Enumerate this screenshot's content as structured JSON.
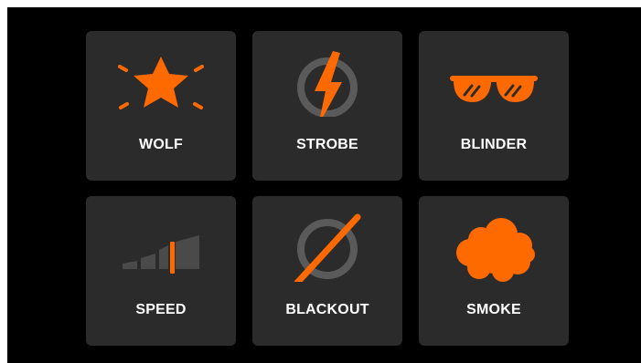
{
  "colors": {
    "accent": "#ff6a00",
    "tile": "#2b2b2b",
    "icon_gray": "#4a4a4a",
    "ring_gray": "#5a5a5a",
    "background": "#000000",
    "label": "#ffffff"
  },
  "tiles": [
    {
      "label": "WOLF",
      "icon": "star-burst-icon"
    },
    {
      "label": "STROBE",
      "icon": "lightning-ring-icon"
    },
    {
      "label": "BLINDER",
      "icon": "sunglasses-icon"
    },
    {
      "label": "SPEED",
      "icon": "speed-bars-icon"
    },
    {
      "label": "BLACKOUT",
      "icon": "blackout-slash-icon"
    },
    {
      "label": "SMOKE",
      "icon": "smoke-cloud-icon"
    }
  ]
}
